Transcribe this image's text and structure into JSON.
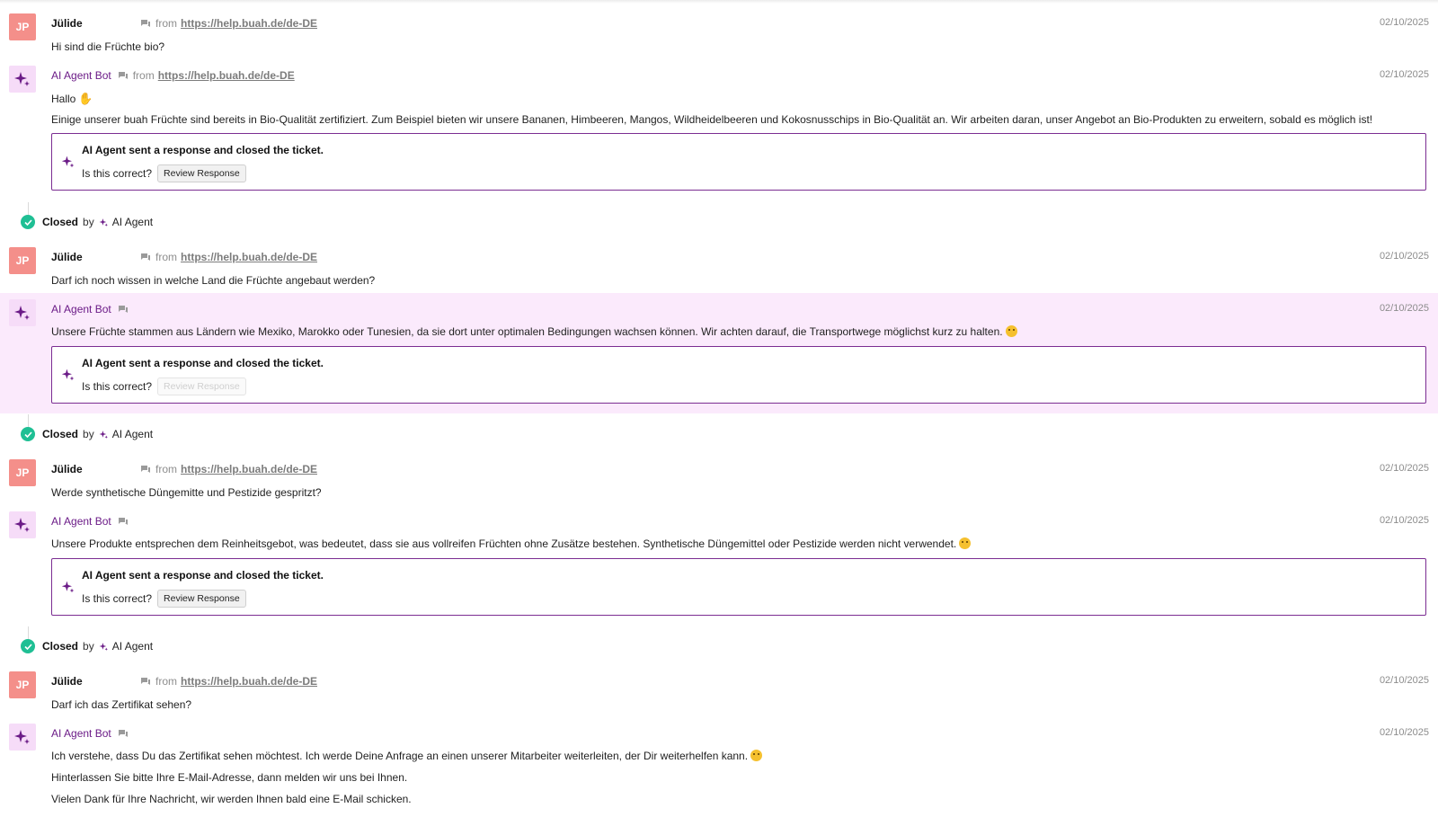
{
  "user": {
    "name": "Jülide",
    "initials": "JP"
  },
  "bot": {
    "name": "AI Agent Bot"
  },
  "channel": {
    "from": "from",
    "url": "https://help.buah.de/de-DE"
  },
  "date": "02/10/2025",
  "card": {
    "title": "AI Agent sent a response and closed the ticket.",
    "question": "Is this correct?",
    "review_label": "Review Response"
  },
  "closed": {
    "status": "Closed",
    "by": "by",
    "agent": "AI Agent"
  },
  "conversation": [
    {
      "user_msg": "Hi sind die Früchte bio?",
      "bot_lines": [
        "Hallo",
        "Einige unserer buah Früchte sind bereits in Bio-Qualität zertifiziert. Zum Beispiel bieten wir unsere Bananen, Himbeeren, Mangos, Wildheidelbeeren und Kokosnusschips in Bio-Qualität an. Wir arbeiten daran, unser Angebot an Bio-Produkten zu erweitern, sobald es möglich ist!"
      ]
    },
    {
      "user_msg": "Darf ich noch wissen in welche Land die Früchte angebaut werden?",
      "bot_lines": [
        "Unsere Früchte stammen aus Ländern wie Mexiko, Marokko oder Tunesien, da sie dort unter optimalen Bedingungen wachsen können. Wir achten darauf, die Transportwege möglichst kurz zu halten."
      ]
    },
    {
      "user_msg": "Werde synthetische Düngemitte und Pestizide gespritzt?",
      "bot_lines": [
        "Unsere Produkte entsprechen dem Reinheitsgebot, was bedeutet, dass sie aus vollreifen Früchten ohne Zusätze bestehen. Synthetische Düngemittel oder Pestizide werden nicht verwendet."
      ]
    },
    {
      "user_msg": "Darf ich das Zertifikat sehen?",
      "bot_lines": [
        "Ich verstehe, dass Du das Zertifikat sehen möchtest. Ich werde Deine Anfrage an einen unserer Mitarbeiter weiterleiten, der Dir weiterhelfen kann.",
        "Hinterlassen Sie bitte Ihre E-Mail-Adresse, dann melden wir uns bei Ihnen.",
        "Vielen Dank für Ihre Nachricht, wir werden Ihnen bald eine E-Mail schicken."
      ]
    }
  ],
  "colors": {
    "accent": "#6b1b87",
    "highlight_bg": "#fbeafc",
    "avatar_user": "#f48f8a",
    "avatar_bot": "#f6dcf8",
    "closed_check": "#1fbf94"
  }
}
